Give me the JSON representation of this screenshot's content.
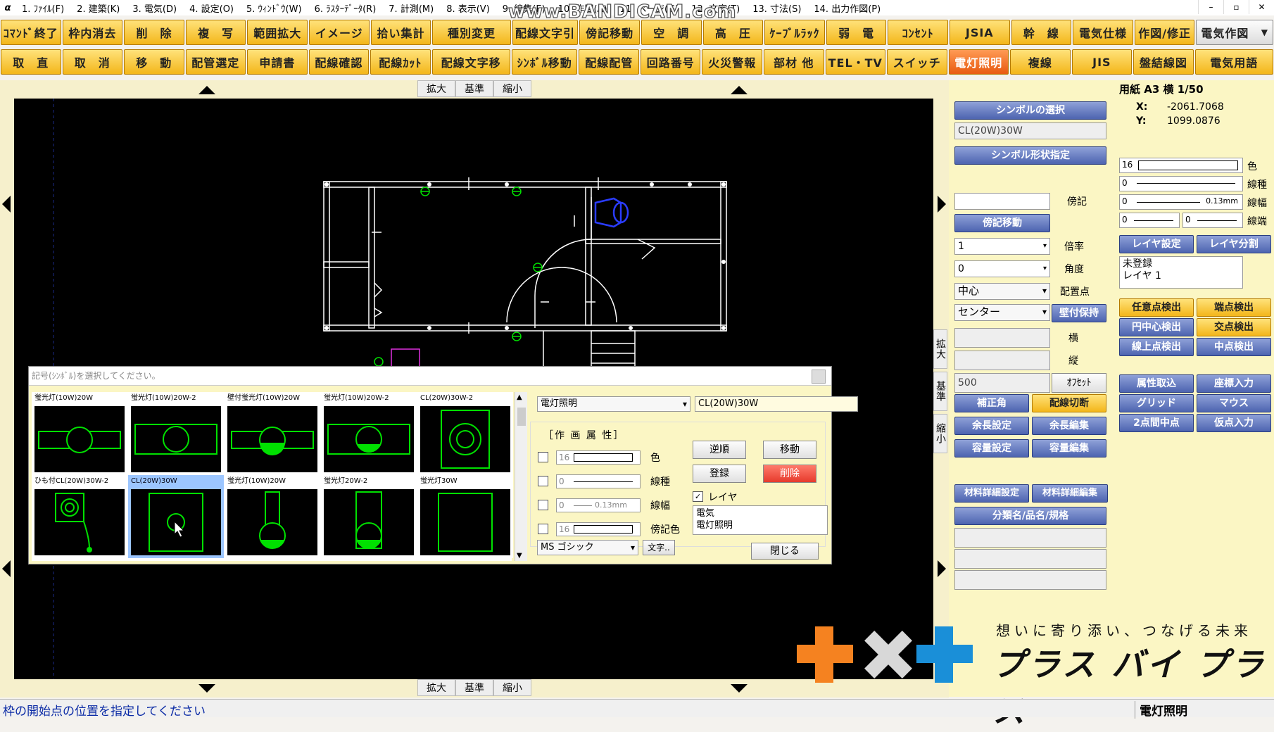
{
  "menu": {
    "items": [
      "1. ﾌｧｲﾙ(F)",
      "2. 建築(K)",
      "3. 電気(D)",
      "4. 設定(O)",
      "5. ｳｨﾝﾄﾞｳ(W)",
      "6. ﾗｽﾀｰﾃﾞｰﾀ(R)",
      "7. 計測(M)",
      "8. 表示(V)",
      "9. 編集(E)",
      "10. 作図(A)",
      "11. ページ(G)",
      "12. 文字(T)",
      "13. 寸法(S)",
      "14. 出力作図(P)"
    ],
    "watermark": "www.BANDICAM.com"
  },
  "toolbar1": [
    "ｺﾏﾝﾄﾞ終了",
    "枠内消去",
    "削　除",
    "複　写",
    "範囲拡大",
    "イメージ",
    "拾い集計",
    "種別変更",
    "配線文字引",
    "傍記移動",
    "空　調",
    "高　圧",
    "ｹｰﾌﾞﾙﾗｯｸ",
    "弱　電",
    "ｺﾝｾﾝﾄ",
    "JSIA",
    "幹　線",
    "電気仕様",
    "作図/修正"
  ],
  "toolbar1_select": "電気作図",
  "toolbar2": [
    "取　直",
    "取　消",
    "移　動",
    "配管選定",
    "申請書",
    "配線確認",
    "配線ｶｯﾄ",
    "配線文字移",
    "ｼﾝﾎﾞﾙ移動",
    "配線配管",
    "回路番号",
    "火災警報",
    "部材 他",
    "TEL・TV",
    "スイッチ",
    "電灯照明",
    "複線",
    "JIS",
    "盤結線図",
    "電気用語"
  ],
  "toolbar2_active": "電灯照明",
  "zoom": {
    "in": "拡大",
    "base": "基準",
    "out": "縮小"
  },
  "side_zoom": {
    "in": "拡大",
    "base": "基準",
    "out": "縮小"
  },
  "dialog": {
    "prompt": "記号(ｼﾝﾎﾞﾙ)を選択してください。",
    "symbols": [
      "蛍光灯(10W)20W",
      "蛍光灯(10W)20W-2",
      "壁付蛍光灯(10W)20W",
      "蛍光灯(10W)20W-2",
      "CL(20W)30W-2",
      "ひも付CL(20W)30W-2",
      "CL(20W)30W",
      "蛍光灯(10W)20W",
      "蛍光灯20W-2",
      "蛍光灯30W"
    ],
    "selected_index": 6,
    "category": "電灯照明",
    "symbol_name": "CL(20W)30W",
    "attr_title": "［作 画 属 性］",
    "attrs": [
      {
        "value": "16",
        "label": "色"
      },
      {
        "value": "0",
        "label": "線種"
      },
      {
        "value": "0",
        "label": "線幅",
        "extra": "0.13mm"
      },
      {
        "value": "16",
        "label": "傍記色"
      }
    ],
    "font": "MS ゴシック",
    "font_button": "文字..",
    "buttons": {
      "reverse": "逆順",
      "move": "移動",
      "register": "登録",
      "delete": "削除",
      "close": "閉じる"
    },
    "layer_label": "レイヤ",
    "layer_checked": true,
    "layer_list": [
      "電気",
      "電灯照明"
    ]
  },
  "panel": {
    "paper": "用紙 A3 横 1/50",
    "x_label": "X:",
    "x_value": "-2061.7068",
    "y_label": "Y:",
    "y_value": "1099.0876",
    "symbol_select": "シンボルの選択",
    "symbol_value": "CL(20W)30W",
    "symbol_shape": "シンボル形状指定",
    "bouki_label": "傍記",
    "bouki_move": "傍記移動",
    "scale_value": "1",
    "scale_label": "倍率",
    "angle_value": "0",
    "angle_label": "角度",
    "place_value": "中心",
    "place_label": "配置点",
    "center_value": "センター",
    "wall_keep": "壁付保持",
    "yoko_label": "横",
    "tate_label": "縦",
    "offset_value": "500",
    "offset_button": "ｵﾌｾｯﾄ",
    "correct_angle": "補正角",
    "wire_cut": "配線切断",
    "margin_set": "余長設定",
    "margin_edit": "余長編集",
    "cap_set": "容量設定",
    "cap_edit": "容量編集",
    "mat_set": "材料詳細設定",
    "mat_edit": "材料詳細編集",
    "category_name": "分類名/品名/規格",
    "color_value": "16",
    "color_label": "色",
    "linetype_value": "0",
    "linetype_label": "線種",
    "linewidth_value": "0",
    "linewidth_mm": "0.13mm",
    "linewidth_label": "線幅",
    "lineend_v1": "0",
    "lineend_v2": "0",
    "lineend_label": "線端",
    "layer_set": "レイヤ設定",
    "layer_split": "レイヤ分割",
    "layer_list": [
      "未登録",
      "レイヤ 1"
    ],
    "snap": [
      "任意点検出",
      "端点検出",
      "円中心検出",
      "交点検出",
      "線上点検出",
      "中点検出"
    ],
    "tools": [
      "属性取込",
      "座標入力",
      "グリッド",
      "マウス",
      "2点間中点",
      "仮点入力"
    ]
  },
  "logo": {
    "tagline": "想いに寄り添い、つなげる未来",
    "brand": "プラス バイ プラス"
  },
  "status": {
    "message": "枠の開始点の位置を指定してください",
    "mode": "電灯照明"
  },
  "colors": {
    "accent": "#f3b61a",
    "active": "#e85a10",
    "blue_button": "#4d64b0",
    "cad_line": "#ffffff",
    "symbol_green": "#00e000",
    "logo_orange": "#f58220",
    "logo_blue": "#1a8fd8"
  }
}
